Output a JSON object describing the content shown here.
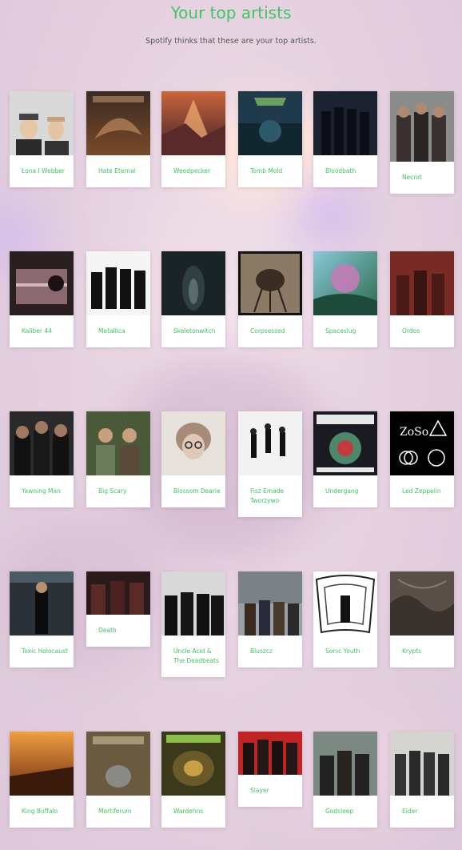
{
  "page": {
    "title": "Your top artists",
    "subtitle": "Spotify thinks that these are your top artists."
  },
  "colors": {
    "accent": "#3fc564",
    "subtitle": "#555555"
  },
  "artists": [
    {
      "name": "Łona I Webber"
    },
    {
      "name": "Hate Eternal"
    },
    {
      "name": "Weedpecker"
    },
    {
      "name": "Tomb Mold"
    },
    {
      "name": "Bloodbath"
    },
    {
      "name": "Necrot"
    },
    {
      "name": "Kaliber 44"
    },
    {
      "name": "Metallica"
    },
    {
      "name": "Skeletonwitch"
    },
    {
      "name": "Corpsessed"
    },
    {
      "name": "Spaceslug"
    },
    {
      "name": "Ordos"
    },
    {
      "name": "Yawning Man"
    },
    {
      "name": "Big Scary"
    },
    {
      "name": "Blossom Dearie"
    },
    {
      "name": "Fisz Emade Tworzywo"
    },
    {
      "name": "Undergang"
    },
    {
      "name": "Led Zeppelin"
    },
    {
      "name": "Toxic Holocaust"
    },
    {
      "name": "Death"
    },
    {
      "name": "Uncle Acid & The Deadbeats"
    },
    {
      "name": "Bluszcz"
    },
    {
      "name": "Sonic Youth"
    },
    {
      "name": "Krypts"
    },
    {
      "name": "King Buffalo"
    },
    {
      "name": "Mortiferum"
    },
    {
      "name": "Wardehns"
    },
    {
      "name": "Slayer"
    },
    {
      "name": "Godsleep"
    },
    {
      "name": "Elder"
    }
  ]
}
